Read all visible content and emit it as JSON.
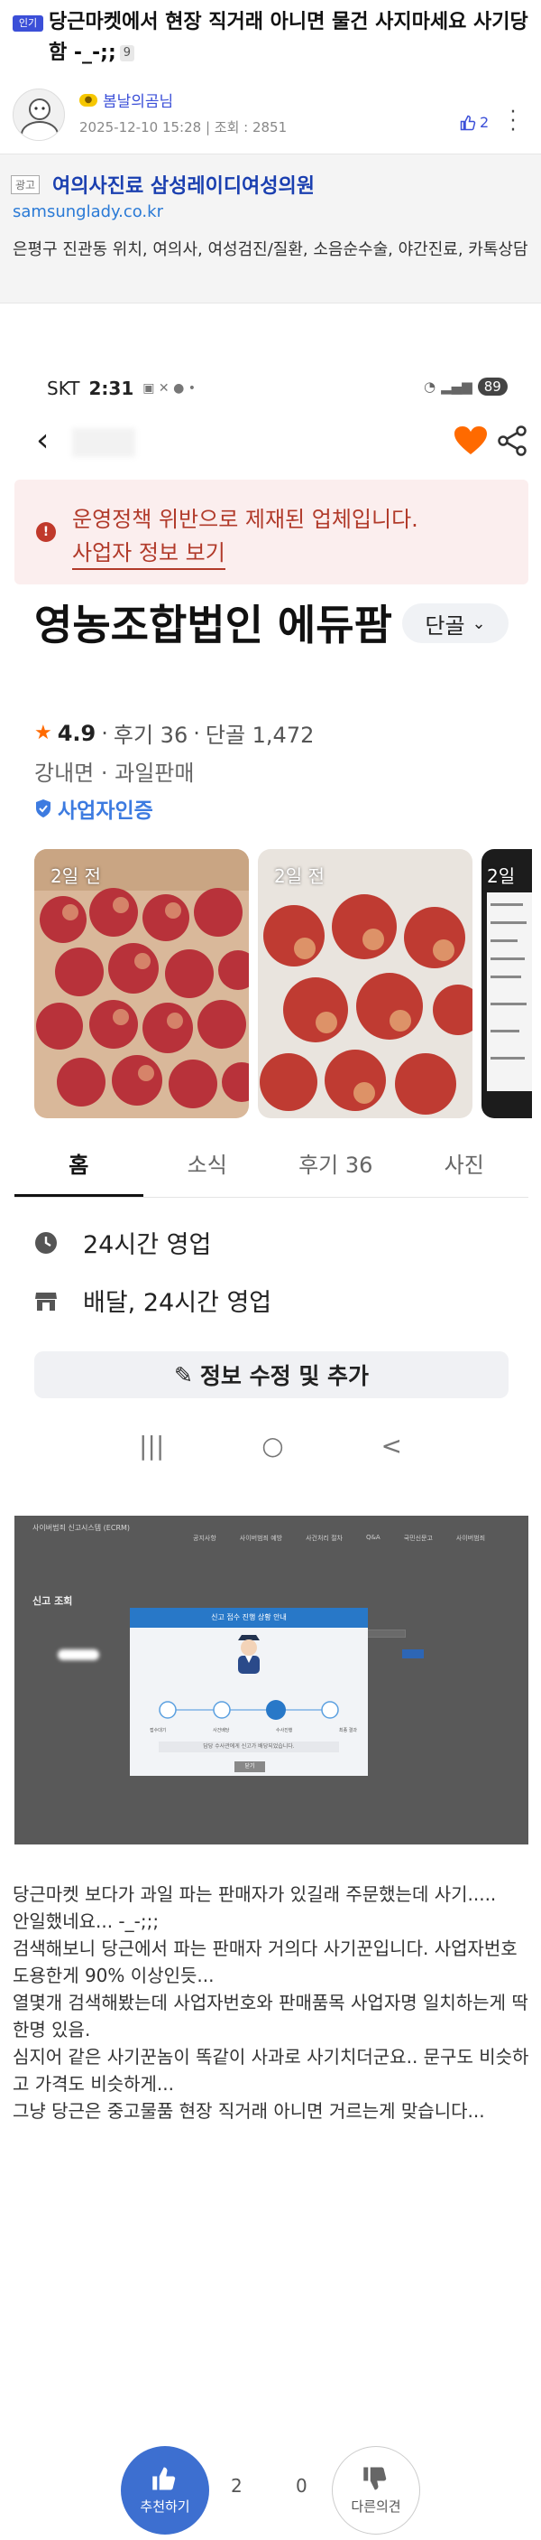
{
  "post": {
    "badge": "인기",
    "title": "당근마켓에서 현장 직거래 아니면 물건 사지마세요 사기당함 -_-;;",
    "comment_count": "9",
    "author": "봄날의곰님",
    "date": "2025-12-10 15:28",
    "views": "조회 : 2851",
    "likes": "2"
  },
  "ad": {
    "tag": "광고",
    "title": "여의사진료 삼성레이디여성의원",
    "url": "samsunglady.co.kr",
    "description": "은평구 진관동 위치, 여의사, 여성검진/질환, 소음순수술, 야간진료, 카톡상담"
  },
  "phone": {
    "status": {
      "carrier": "SKT",
      "time": "2:31",
      "battery": "89"
    },
    "warning": {
      "text": "운영정책 위반으로 제재된 업체입니다.",
      "link": "사업자 정보 보기"
    },
    "shop": {
      "name": "영농조합법인 에듀팜",
      "regular_label": "단골",
      "rating": "4.9",
      "reviews": "후기 36",
      "regulars": "단골 1,472",
      "location": "강내면 · 과일판매",
      "verified": "사업자인증"
    },
    "photos": [
      {
        "badge": "2일 전"
      },
      {
        "badge": "2일 전"
      },
      {
        "badge": "2일"
      }
    ],
    "tabs": [
      "홈",
      "소식",
      "후기 36",
      "사진"
    ],
    "info": {
      "hours": "24시간 영업",
      "delivery": "배달, 24시간 영업"
    },
    "edit_button": "정보 수정 및 추가",
    "nav": {
      "recent": "|||",
      "home": "○",
      "back": "<"
    }
  },
  "report_screen": {
    "site_title": "사이버범죄 신고시스템 (ECRM)",
    "menu": [
      "공지사항",
      "사이버범죄 예방",
      "사건처리 절차",
      "Q&A",
      "국민신문고",
      "사이버범죄"
    ],
    "heading": "신고 조회",
    "modal_title": "신고 접수 진행 상황 안내",
    "steps": [
      "접수대기",
      "사건배당",
      "수사진행",
      "최종 결과"
    ],
    "note": "담당 수사관에게 신고가 배당되었습니다.",
    "ok_button": "닫기"
  },
  "body": {
    "paragraphs": [
      "당근마켓 보다가 과일 파는 판매자가 있길래 주문했는데 사기.....",
      "안일했네요...  -_-;;;",
      "검색해보니 당근에서 파는 판매자 거의다 사기꾼입니다.  사업자번호 도용한게 90% 이상인듯...",
      "열몇개 검색해봤는데 사업자번호와 판매품목 사업자명 일치하는게 딱 한명 있음.",
      "심지어 같은 사기꾼놈이 똑같이 사과로 사기치더군요.. 문구도 비슷하고 가격도 비슷하게...",
      "그냥 당근은 중고물품 현장 직거래 아니면 거르는게 맞습니다..."
    ]
  },
  "vote": {
    "up_label": "추천하기",
    "up_count": "2",
    "down_count": "0",
    "down_label": "다른의견"
  },
  "colors": {
    "accent": "#3b4fd8",
    "warning": "#b13a2a",
    "verified": "#3d7be0",
    "heart": "#ff6a00"
  }
}
